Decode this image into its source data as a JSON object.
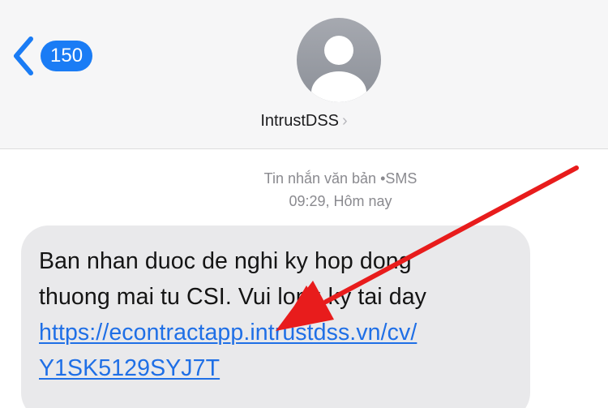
{
  "header": {
    "back_badge_count": "150",
    "contact_name": "IntrustDSS",
    "contact_chevron": "›"
  },
  "thread": {
    "meta_line1": "Tin nhắn văn bản •SMS",
    "meta_line2": "09:29, Hôm nay"
  },
  "message": {
    "line1": "Ban nhan duoc de nghi ky hop dong",
    "line2": "thuong mai tu CSI. Vui long ky tai day",
    "link_line1": "https://econtractapp.intrustdss.vn/cv/",
    "link_line2": "Y1SK5129SYJ7T"
  },
  "colors": {
    "accent_blue": "#1a7cf5",
    "link_blue": "#1f6fe6",
    "bubble_gray": "#e9e9eb",
    "annotation_red": "#e81c1c"
  },
  "icons": {
    "back": "chevron-left-icon",
    "avatar": "person-icon",
    "annotation": "red-arrow-annotation"
  }
}
